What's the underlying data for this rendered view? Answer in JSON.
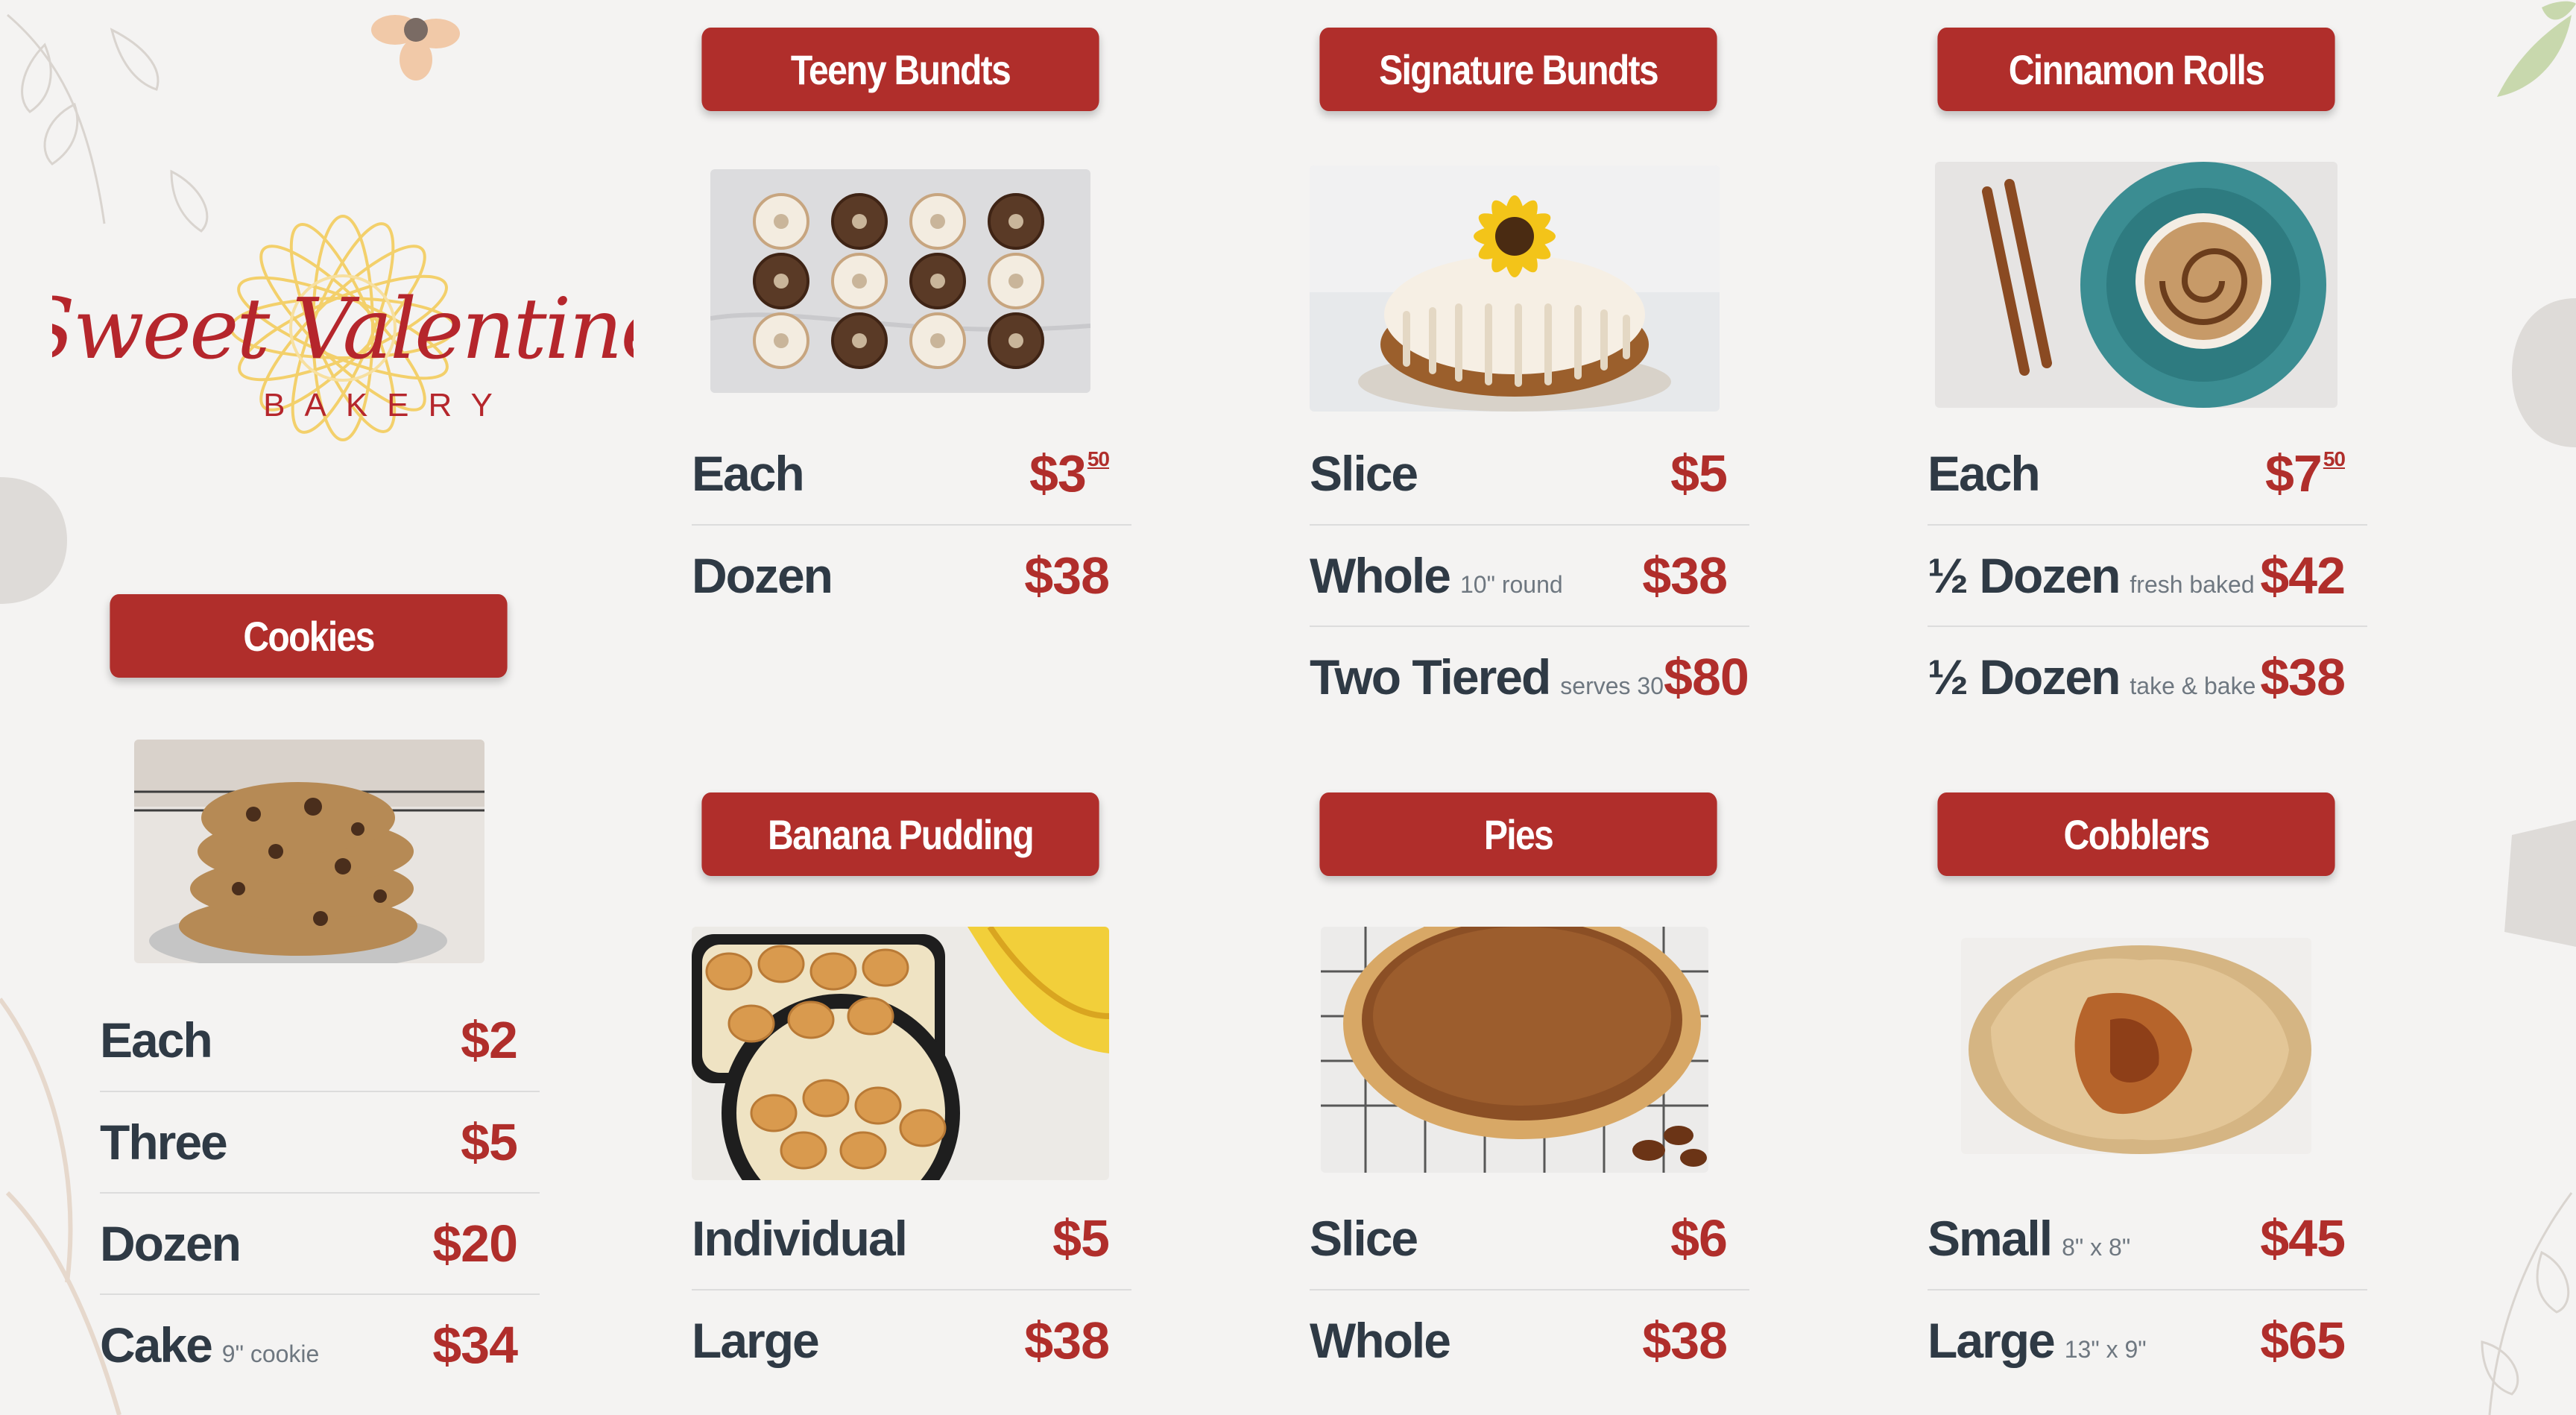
{
  "brand": {
    "name_script": "Sweet Valentine",
    "name_sub": "BAKERY",
    "colors": {
      "accent": "#b02e2b",
      "text": "#2f3a45",
      "muted": "#6e7780",
      "sunflower": "#f3d06b"
    }
  },
  "sections": {
    "cookies": {
      "title": "Cookies",
      "photo": "cookies-photo",
      "rows": [
        {
          "label": "Each",
          "note": "",
          "price": "$2"
        },
        {
          "label": "Three",
          "note": "",
          "price": "$5"
        },
        {
          "label": "Dozen",
          "note": "",
          "price": "$20"
        },
        {
          "label": "Cake",
          "note": "9\" cookie",
          "price": "$34"
        }
      ]
    },
    "teeny": {
      "title": "Teeny Bundts",
      "photo": "teeny-bundts-photo",
      "rows": [
        {
          "label": "Each",
          "note": "",
          "price": "$3",
          "cents": "50"
        },
        {
          "label": "Dozen",
          "note": "",
          "price": "$38"
        }
      ]
    },
    "signature": {
      "title": "Signature Bundts",
      "photo": "signature-bundt-photo",
      "rows": [
        {
          "label": "Slice",
          "note": "",
          "price": "$5"
        },
        {
          "label": "Whole",
          "note": "10\" round",
          "price": "$38"
        },
        {
          "label": "Two Tiered",
          "note": "serves 30",
          "price": "$80"
        }
      ]
    },
    "cinnamon": {
      "title": "Cinnamon Rolls",
      "photo": "cinnamon-roll-photo",
      "rows": [
        {
          "label": "Each",
          "note": "",
          "price": "$7",
          "cents": "50"
        },
        {
          "label": "½ Dozen",
          "note": "fresh baked",
          "price": "$42"
        },
        {
          "label": "½ Dozen",
          "note": "take & bake",
          "price": "$38"
        }
      ]
    },
    "banana": {
      "title": "Banana Pudding",
      "photo": "banana-pudding-photo",
      "rows": [
        {
          "label": "Individual",
          "note": "",
          "price": "$5"
        },
        {
          "label": "Large",
          "note": "",
          "price": "$38"
        }
      ]
    },
    "pies": {
      "title": "Pies",
      "photo": "pecan-pie-photo",
      "rows": [
        {
          "label": "Slice",
          "note": "",
          "price": "$6"
        },
        {
          "label": "Whole",
          "note": "",
          "price": "$38"
        }
      ]
    },
    "cobblers": {
      "title": "Cobblers",
      "photo": "cobbler-photo",
      "rows": [
        {
          "label": "Small",
          "note": "8\" x 8\"",
          "price": "$45"
        },
        {
          "label": "Large",
          "note": "13\" x 9\"",
          "price": "$65"
        }
      ]
    }
  }
}
